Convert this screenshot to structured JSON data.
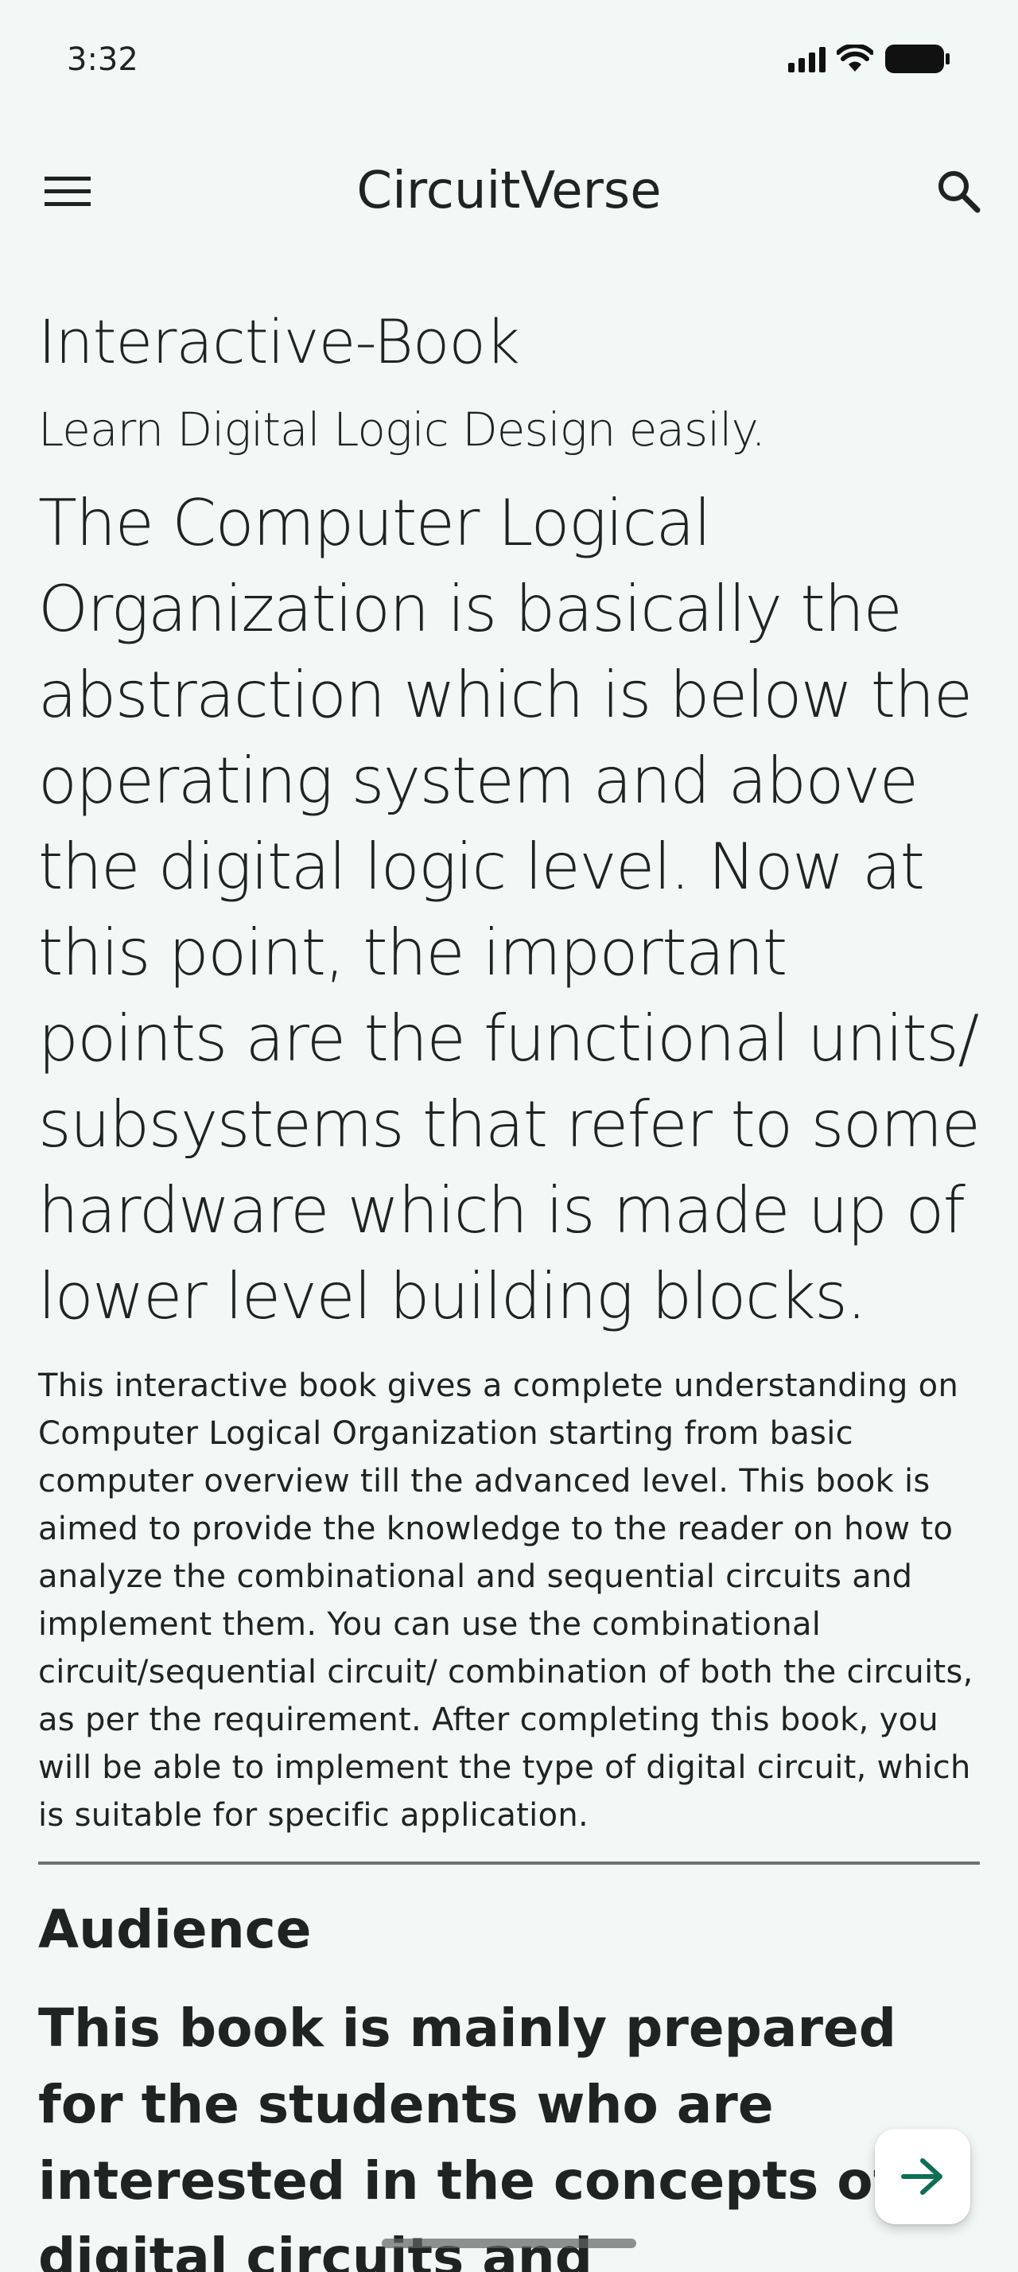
{
  "status_bar": {
    "time": "3:32"
  },
  "app_bar": {
    "title": "CircuitVerse",
    "menu_icon": "hamburger-menu-icon",
    "search_icon": "search-icon"
  },
  "content": {
    "title": "Interactive-Book",
    "subtitle": "Learn Digital Logic Design easily.",
    "intro": "The Computer Logical Organization is basically the abstraction which is below the operating system and above the digital logic level. Now at this point, the important points are the functional units/ subsystems that refer to some hardware which is made up of lower level building blocks.",
    "body": "This interactive book gives a complete understanding on Computer Logical Organization starting from basic computer overview till the advanced level. This book is aimed to provide the knowledge to the reader on how to analyze the combinational and sequential circuits and implement them. You can use the combinational circuit/sequential circuit/ combination of both the circuits, as per the requirement. After completing this book, you will be able to implement the type of digital circuit, which is suitable for specific application.",
    "section_heading": "Audience",
    "section_lead": "This book is mainly prepared for the students who are interested in the concepts of digital circuits and"
  },
  "fab": {
    "icon": "arrow-right-icon",
    "accent": "#0f6e56"
  }
}
